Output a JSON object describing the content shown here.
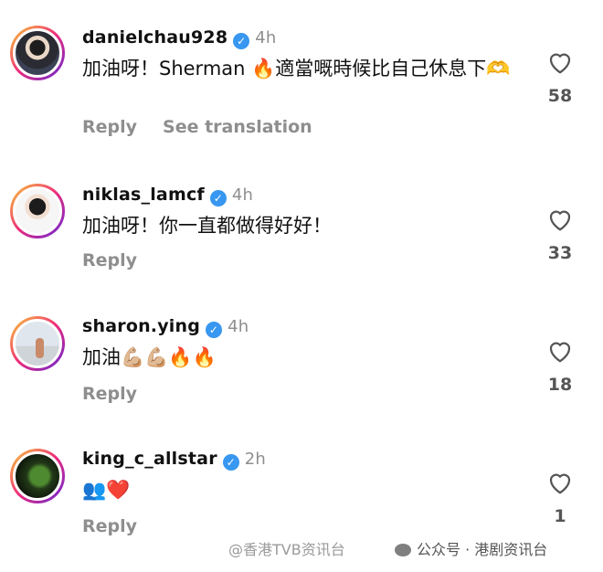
{
  "comments": [
    {
      "username": "danielchau928",
      "time": "4h",
      "text": "加油呀！Sherman 🔥適當嘅時候比自己休息下🫶",
      "actions": [
        "Reply",
        "See translation"
      ],
      "likes": "58"
    },
    {
      "username": "niklas_lamcf",
      "time": "4h",
      "text": "加油呀！你一直都做得好好！",
      "actions": [
        "Reply"
      ],
      "likes": "33"
    },
    {
      "username": "sharon.ying",
      "time": "4h",
      "text": "加油💪🏼💪🏼🔥🔥",
      "actions": [
        "Reply"
      ],
      "likes": "18"
    },
    {
      "username": "king_c_allstar",
      "time": "2h",
      "text": "👥❤️",
      "actions": [
        "Reply"
      ],
      "likes": "1"
    }
  ],
  "watermarks": {
    "left": "@香港TVB资讯台",
    "right": "公众号 · 港剧资讯台"
  },
  "colors": {
    "verified": "#3897f0",
    "muted": "#8e8e8e"
  }
}
